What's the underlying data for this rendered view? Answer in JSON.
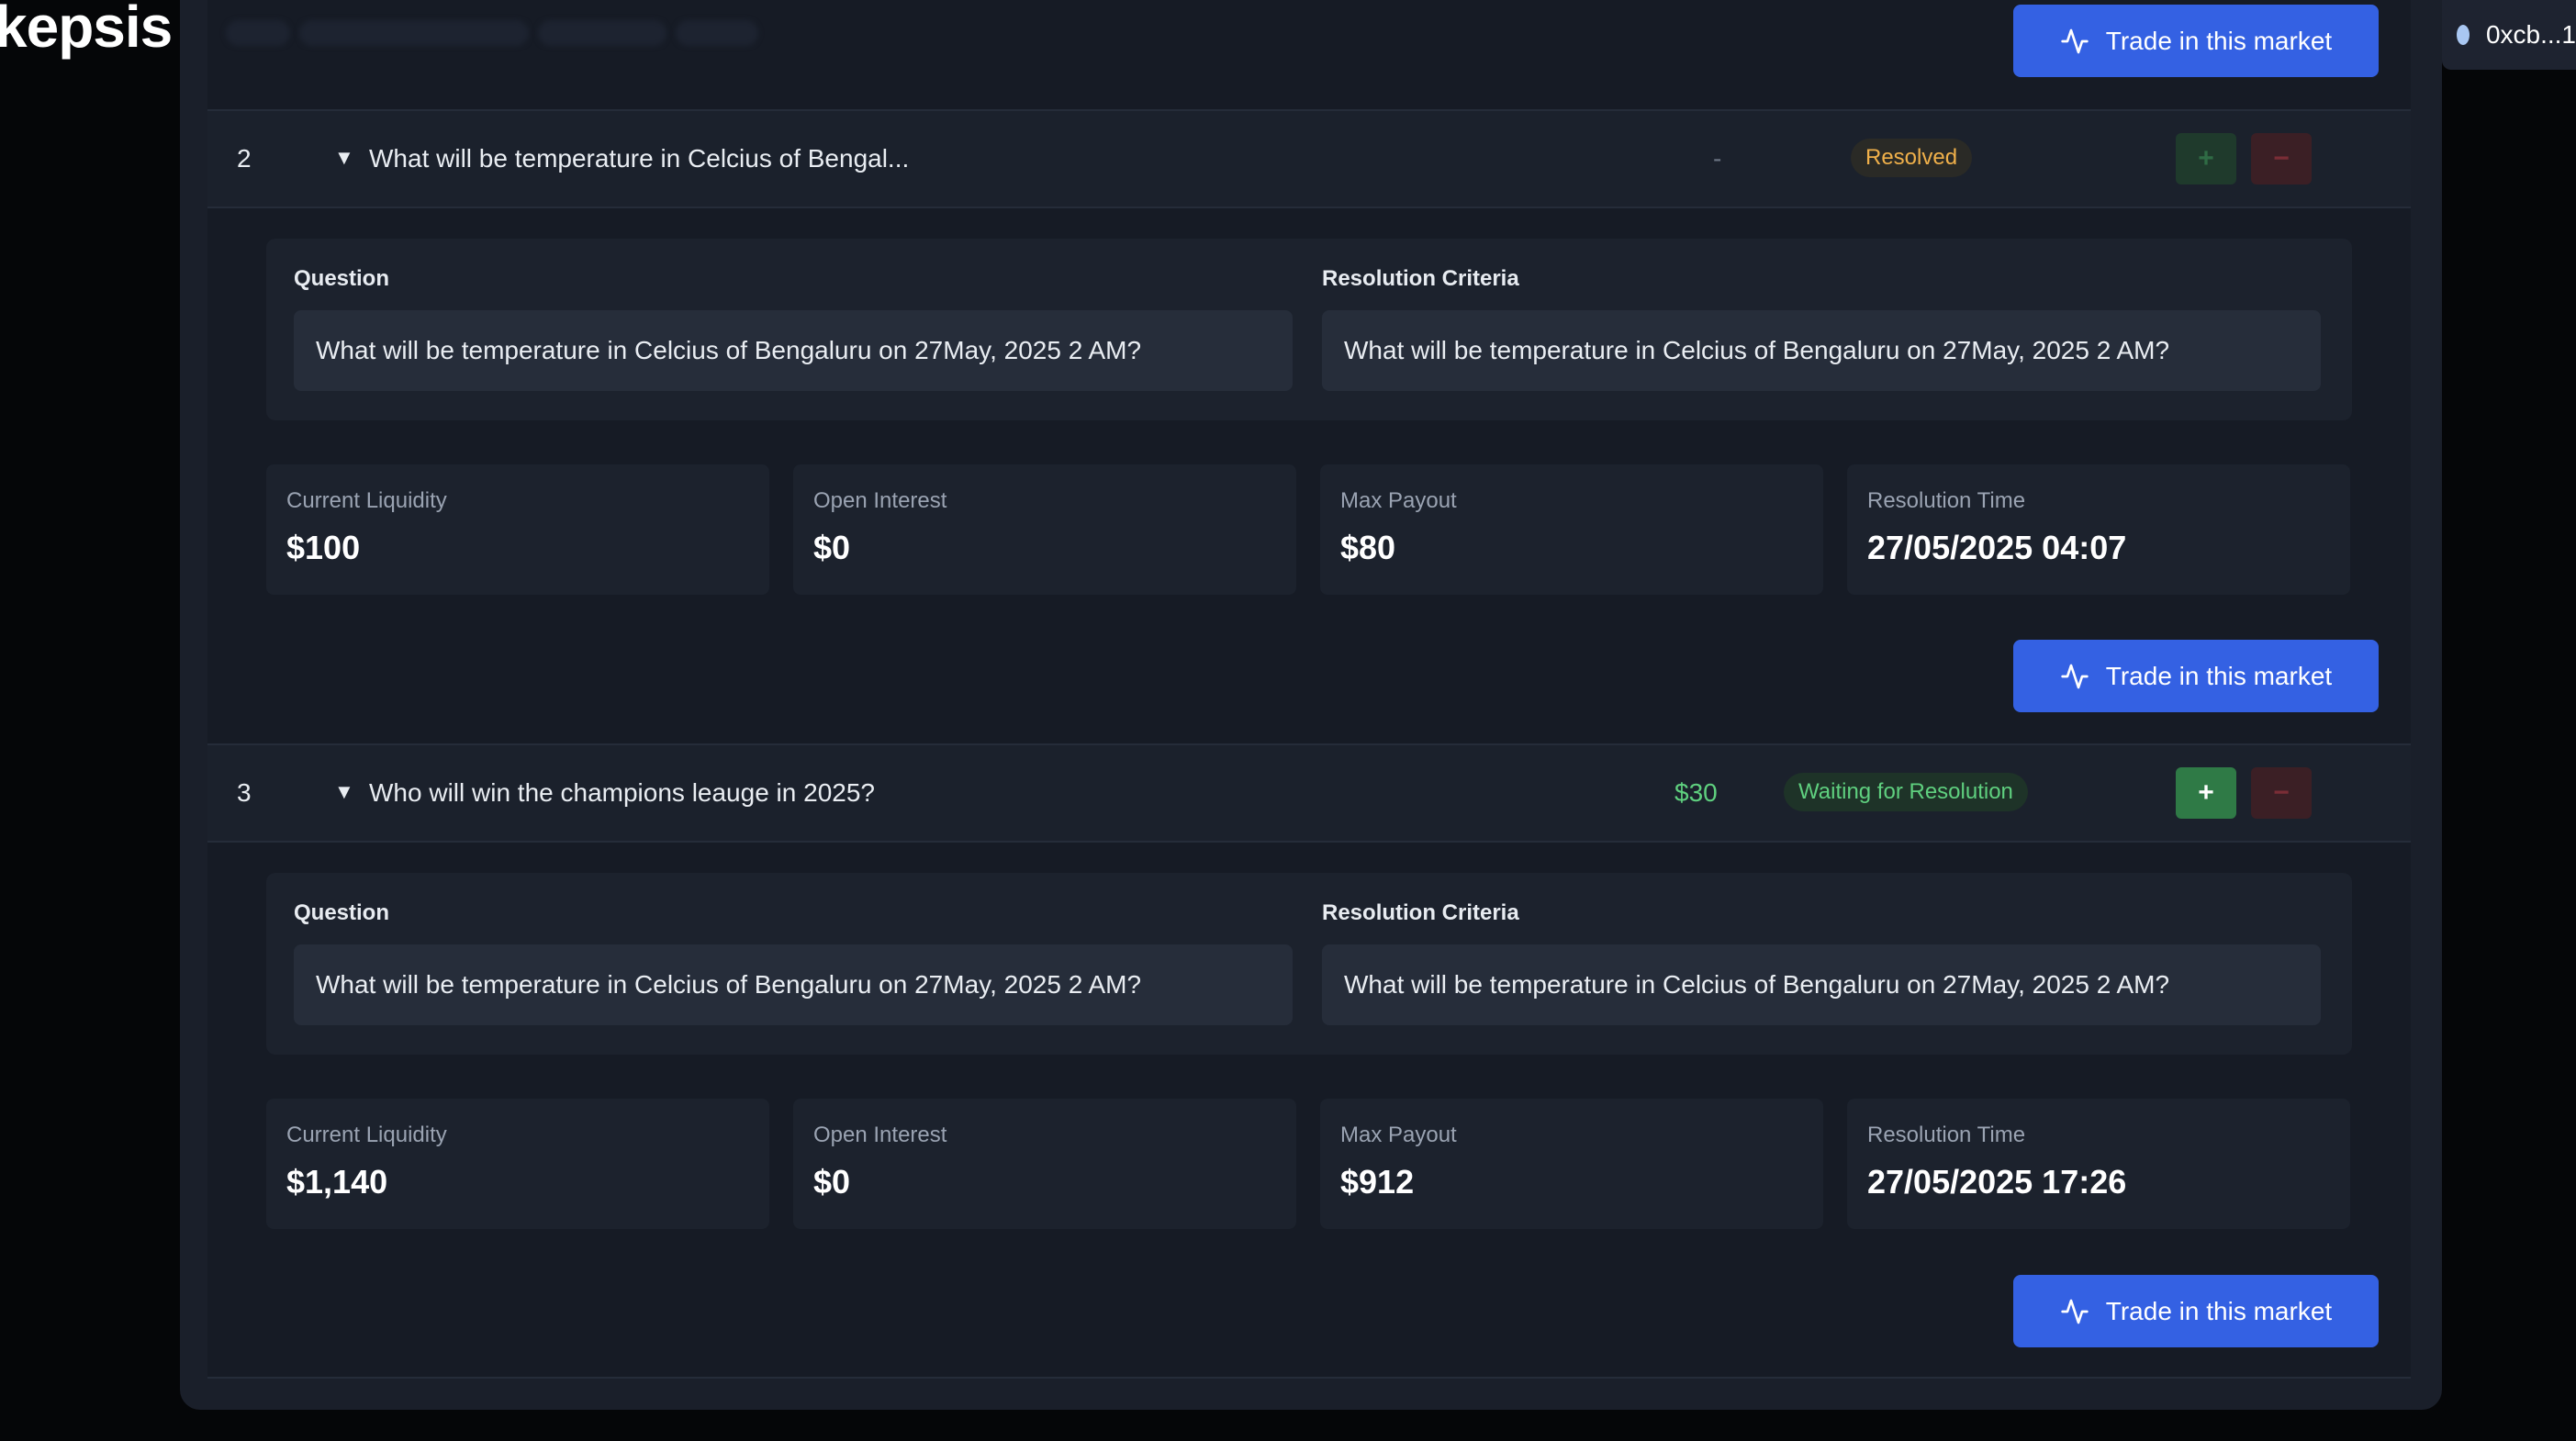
{
  "app": {
    "logo_text": "kepsis"
  },
  "wallet": {
    "address": "0xcb...1"
  },
  "trade_button_label": "Trade in this market",
  "markets": [
    {
      "index": "2",
      "title": "What will be temperature in Celcius of Bengal...",
      "amount": "-",
      "status": "Resolved",
      "status_color": "#f0b04a",
      "buttons_enabled": false,
      "question_label": "Question",
      "question": "What will be temperature in Celcius of Bengaluru on 27May, 2025 2 AM?",
      "criteria_label": "Resolution Criteria",
      "criteria": "What will be temperature in Celcius of Bengaluru on 27May, 2025 2 AM?",
      "stats": [
        {
          "label": "Current Liquidity",
          "value": "$100"
        },
        {
          "label": "Open Interest",
          "value": "$0"
        },
        {
          "label": "Max Payout",
          "value": "$80"
        },
        {
          "label": "Resolution Time",
          "value": "27/05/2025 04:07"
        }
      ]
    },
    {
      "index": "3",
      "title": "Who will win the champions leauge in 2025?",
      "amount": "$30",
      "status": "Waiting for Resolution",
      "status_color": "#5fd07f",
      "buttons_enabled": true,
      "question_label": "Question",
      "question": "What will be temperature in Celcius of Bengaluru on 27May, 2025 2 AM?",
      "criteria_label": "Resolution Criteria",
      "criteria": "What will be temperature in Celcius of Bengaluru on 27May, 2025 2 AM?",
      "stats": [
        {
          "label": "Current Liquidity",
          "value": "$1,140"
        },
        {
          "label": "Open Interest",
          "value": "$0"
        },
        {
          "label": "Max Payout",
          "value": "$912"
        },
        {
          "label": "Resolution Time",
          "value": "27/05/2025 17:26"
        }
      ]
    }
  ],
  "plus_symbol": "+",
  "minus_symbol": "−",
  "expand_arrow": "▼"
}
